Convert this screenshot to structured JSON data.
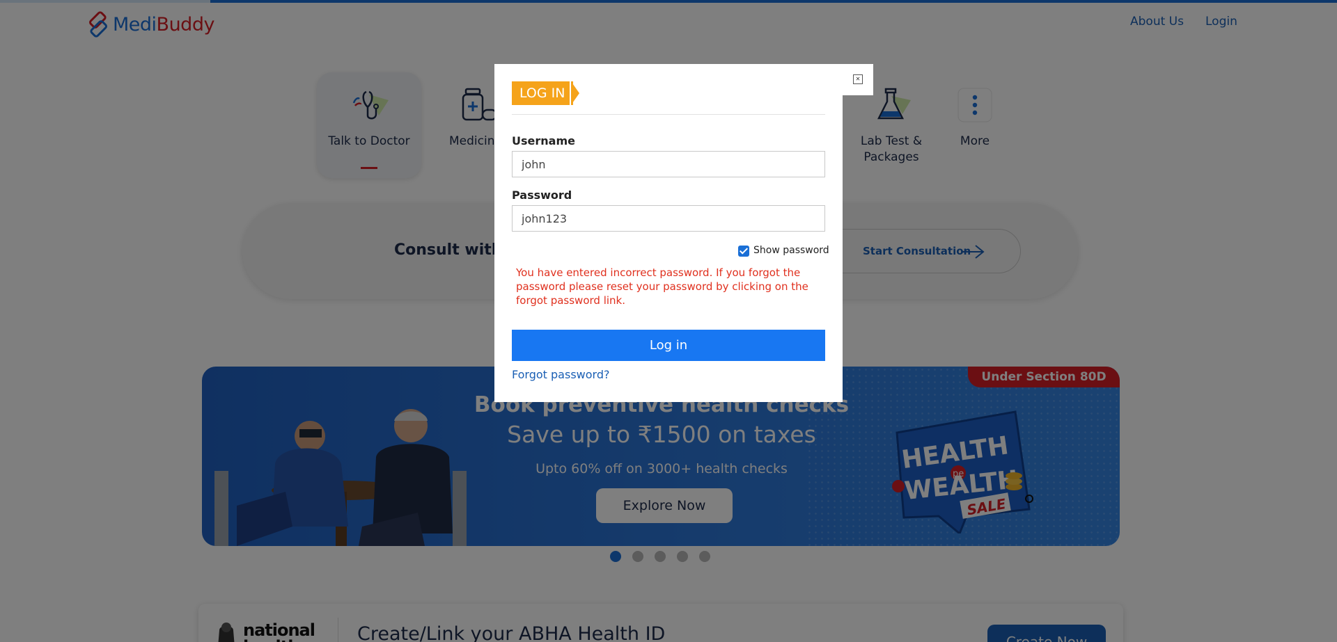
{
  "header": {
    "brand": {
      "part1": "Medi",
      "part2": "Buddy"
    },
    "nav": [
      {
        "label": "About Us"
      },
      {
        "label": "Login"
      }
    ]
  },
  "services": [
    {
      "label": "Talk to Doctor",
      "icon": "stethoscope-icon",
      "active": true
    },
    {
      "label": "Medicines",
      "icon": "medicine-bottle-icon",
      "active": false
    },
    {
      "label": "Lab Test & Packages",
      "icon": "flask-icon",
      "active": false
    },
    {
      "label": "More",
      "icon": "more-vertical-icon",
      "active": false
    }
  ],
  "consult": {
    "title": "Consult with Top Doctors",
    "button_label": "Start Consultation"
  },
  "banner": {
    "ribbon": "Under Section 80D",
    "title": "Book preventive health checks",
    "subtitle": "Save up to ₹1500 on taxes",
    "description": "Upto 60% off on 3000+ health checks",
    "cta": "Explore Now",
    "badge_text": [
      "HEALTH",
      "pe",
      "WEALTH",
      "SALE"
    ],
    "slide_count": 5,
    "active_slide": 1
  },
  "abha": {
    "logo_text": [
      "national",
      "health"
    ],
    "title": "Create/Link your ABHA Health ID",
    "button_label": "Create Now"
  },
  "modal": {
    "tag": "LOG IN",
    "username_label": "Username",
    "username_value": "john",
    "password_label": "Password",
    "password_value": "john123",
    "show_password_label": "Show password",
    "show_password_checked": true,
    "error": "You have entered incorrect password. If you forgot the password please reset your password by clicking on the forgot password link.",
    "submit_label": "Log in",
    "forgot_label": "Forgot password?"
  },
  "colors": {
    "brand_blue": "#1a6fd6",
    "brand_red": "#d61f26",
    "tag_orange": "#f5a31a",
    "error_red": "#e0301e",
    "button_blue": "#1877f2"
  }
}
